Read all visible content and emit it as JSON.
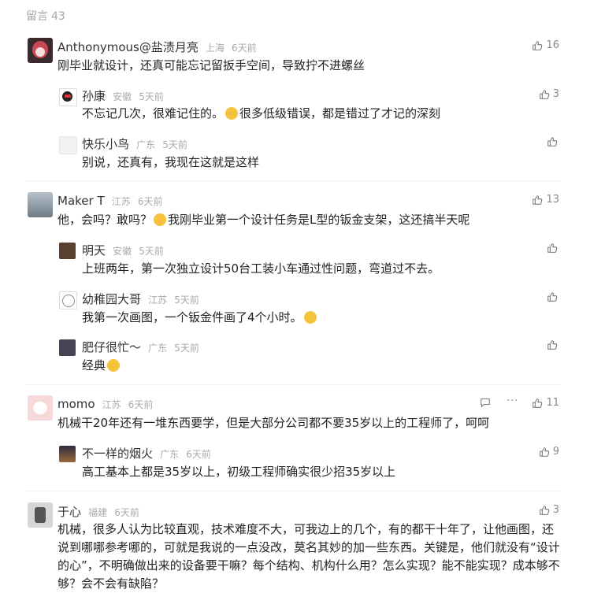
{
  "header": {
    "label": "留言",
    "count": "43"
  },
  "comments": [
    {
      "name": "Anthonymous@盐渍月亮",
      "location": "上海",
      "time": "6天前",
      "text": "刚毕业就设计，还真可能忘记留扳手空间，导致拧不进螺丝",
      "likes": "16",
      "replies": [
        {
          "name": "孙康",
          "location": "安徽",
          "time": "5天前",
          "text_a": "不忘记几次，很难记住的。",
          "text_b": "很多低级错误，都是错过了才记的深刻",
          "likes": "3"
        },
        {
          "name": "快乐小鸟",
          "location": "广东",
          "time": "5天前",
          "text": "别说，还真有，我现在这就是这样",
          "likes": ""
        }
      ]
    },
    {
      "name": "Maker T",
      "location": "江苏",
      "time": "6天前",
      "text_a": "他，会吗？敢吗？",
      "text_b": "我刚毕业第一个设计任务是L型的钣金支架，这还搞半天呢",
      "likes": "13",
      "replies": [
        {
          "name": "明天",
          "location": "安徽",
          "time": "5天前",
          "text": "上班两年，第一次独立设计50台工装小车通过性问题，弯道过不去。",
          "likes": ""
        },
        {
          "name": "幼稚园大哥",
          "location": "江苏",
          "time": "5天前",
          "text": "我第一次画图，一个钣金件画了4个小时。",
          "likes": ""
        },
        {
          "name": "肥仔很忙～",
          "location": "广东",
          "time": "5天前",
          "text": "经典",
          "likes": ""
        }
      ]
    },
    {
      "name": "momo",
      "location": "江苏",
      "time": "6天前",
      "text": "机械干20年还有一堆东西要学，但是大部分公司都不要35岁以上的工程师了，呵呵",
      "likes": "11",
      "replies": [
        {
          "name": "不一样的烟火",
          "location": "广东",
          "time": "6天前",
          "text": "高工基本上都是35岁以上，初级工程师确实很少招35岁以上",
          "likes": "9"
        }
      ]
    },
    {
      "name": "于心",
      "location": "福建",
      "time": "6天前",
      "text": "机械，很多人认为比较直观，技术难度不大，可我边上的几个，有的都干十年了，让他画图，还说到哪哪参考哪的，可就是我说的一点没改，莫名其妙的加一些东西。关键是，他们就没有“设计的心”，不明确做出来的设备要干嘛？每个结构、机构什么用？怎么实现？能不能实现？成本够不够？会不会有缺陷？",
      "likes": "3"
    }
  ],
  "colors": {
    "meta_gray": "#aaaaaa",
    "text": "#222222",
    "emoji": "#f5c33b"
  }
}
